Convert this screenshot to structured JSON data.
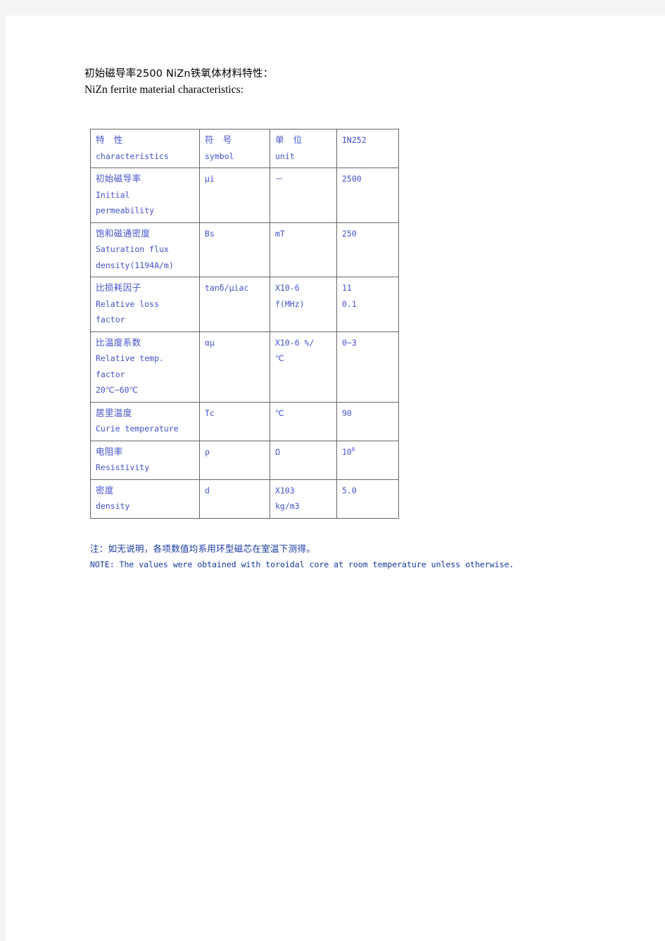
{
  "heading": {
    "line_cn": "初始磁导率2500 NiZn铁氧体材料特性：",
    "line_en": "NiZn ferrite material characteristics:"
  },
  "table": {
    "columns": [
      {
        "cn": "特　性",
        "en": "characteristics"
      },
      {
        "cn": "符　号",
        "en": "symbol"
      },
      {
        "cn": "单　位",
        "en": "unit"
      },
      {
        "cn": "IN252",
        "en": ""
      }
    ],
    "rows": [
      {
        "characteristic_cn": "初始磁导率",
        "characteristic_en": [
          "Initial",
          "permeability"
        ],
        "symbol": [
          "μi"
        ],
        "unit": [
          "－"
        ],
        "value": [
          "2500"
        ]
      },
      {
        "characteristic_cn": "饱和磁通密度",
        "characteristic_en": [
          "Saturation flux",
          "density(1194A/m)"
        ],
        "symbol": [
          "Bs"
        ],
        "unit": [
          "mT"
        ],
        "value": [
          "250"
        ]
      },
      {
        "characteristic_cn": "比损耗因子",
        "characteristic_en": [
          "Relative loss",
          "factor"
        ],
        "symbol": [
          "tanδ/μiac"
        ],
        "unit": [
          "X10-6",
          "f(MHz)"
        ],
        "value": [
          "11",
          "0.1"
        ]
      },
      {
        "characteristic_cn": "比温度系数",
        "characteristic_en": [
          "Relative temp.",
          "factor",
          "20℃~60℃"
        ],
        "symbol": [
          "αμ"
        ],
        "unit": [
          "X10-6 %/",
          "℃"
        ],
        "value": [
          "0~3"
        ]
      },
      {
        "characteristic_cn": "居里温度",
        "characteristic_en": [
          "Curie temperature"
        ],
        "symbol": [
          "Tc"
        ],
        "unit": [
          "℃"
        ],
        "value": [
          "90"
        ]
      },
      {
        "characteristic_cn": "电阻率",
        "characteristic_en": [
          "Resistivity"
        ],
        "symbol": [
          "ρ"
        ],
        "unit": [
          "Ω"
        ],
        "value": [
          "10"
        ],
        "value_exponent": "6"
      },
      {
        "characteristic_cn": "密度",
        "characteristic_en": [
          "density"
        ],
        "symbol": [
          "d"
        ],
        "unit": [
          "X103",
          "kg/m3"
        ],
        "value": [
          "5.0"
        ]
      }
    ]
  },
  "notes": {
    "note_cn": "注：如无说明，各项数值均系用环型磁芯在室温下测得。",
    "note_en": "NOTE: The values were obtained with toroidal core at room temperature unless otherwise."
  },
  "colors": {
    "table_text": "#4352cc",
    "note_text": "#15389e",
    "border": "#666666",
    "page_background": "#ffffff",
    "canvas_background": "#f4f4f4"
  }
}
